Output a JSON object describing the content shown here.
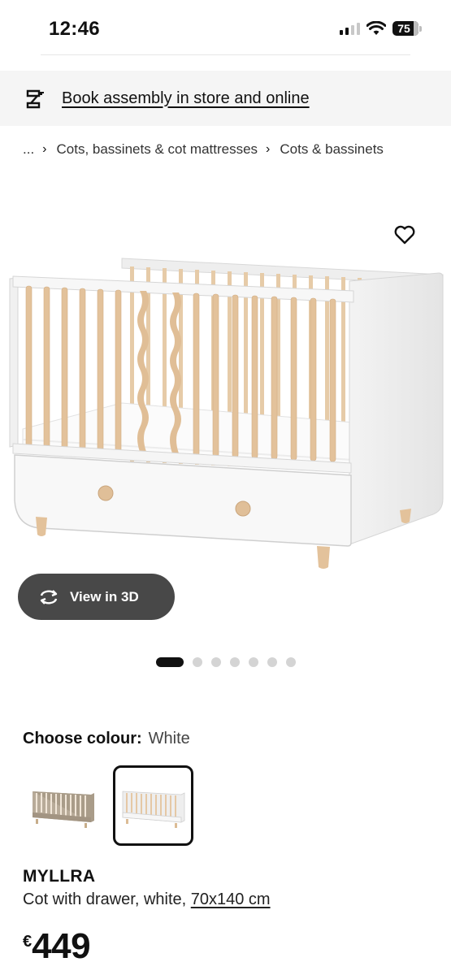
{
  "status_bar": {
    "time": "12:46",
    "battery_level": "75",
    "icons": [
      "signal-icon",
      "wifi-icon",
      "battery-icon"
    ]
  },
  "banner": {
    "icon": "drill-icon",
    "link_text": "Book assembly in store and online"
  },
  "breadcrumb": {
    "ellipsis": "...",
    "items": [
      "Cots, bassinets & cot mattresses",
      "Cots & bassinets"
    ]
  },
  "gallery": {
    "favourite_icon": "heart-icon",
    "view_3d_label": "View in 3D",
    "view_3d_icon": "rotate-icon",
    "image_count": 7,
    "active_index": 0
  },
  "colour": {
    "label": "Choose colour:",
    "value": "White",
    "options": [
      {
        "name": "beige",
        "selected": false,
        "color": "#b5a998"
      },
      {
        "name": "white",
        "selected": true,
        "color": "#f2f2f2"
      }
    ]
  },
  "product": {
    "name": "MYLLRA",
    "description": "Cot with drawer, white, ",
    "size": "70x140 cm",
    "currency": "€",
    "price": "449"
  },
  "colors": {
    "text": "#111111",
    "banner_bg": "#f5f5f5",
    "view3d_bg": "#484848",
    "wood": "#e3c7a4"
  }
}
